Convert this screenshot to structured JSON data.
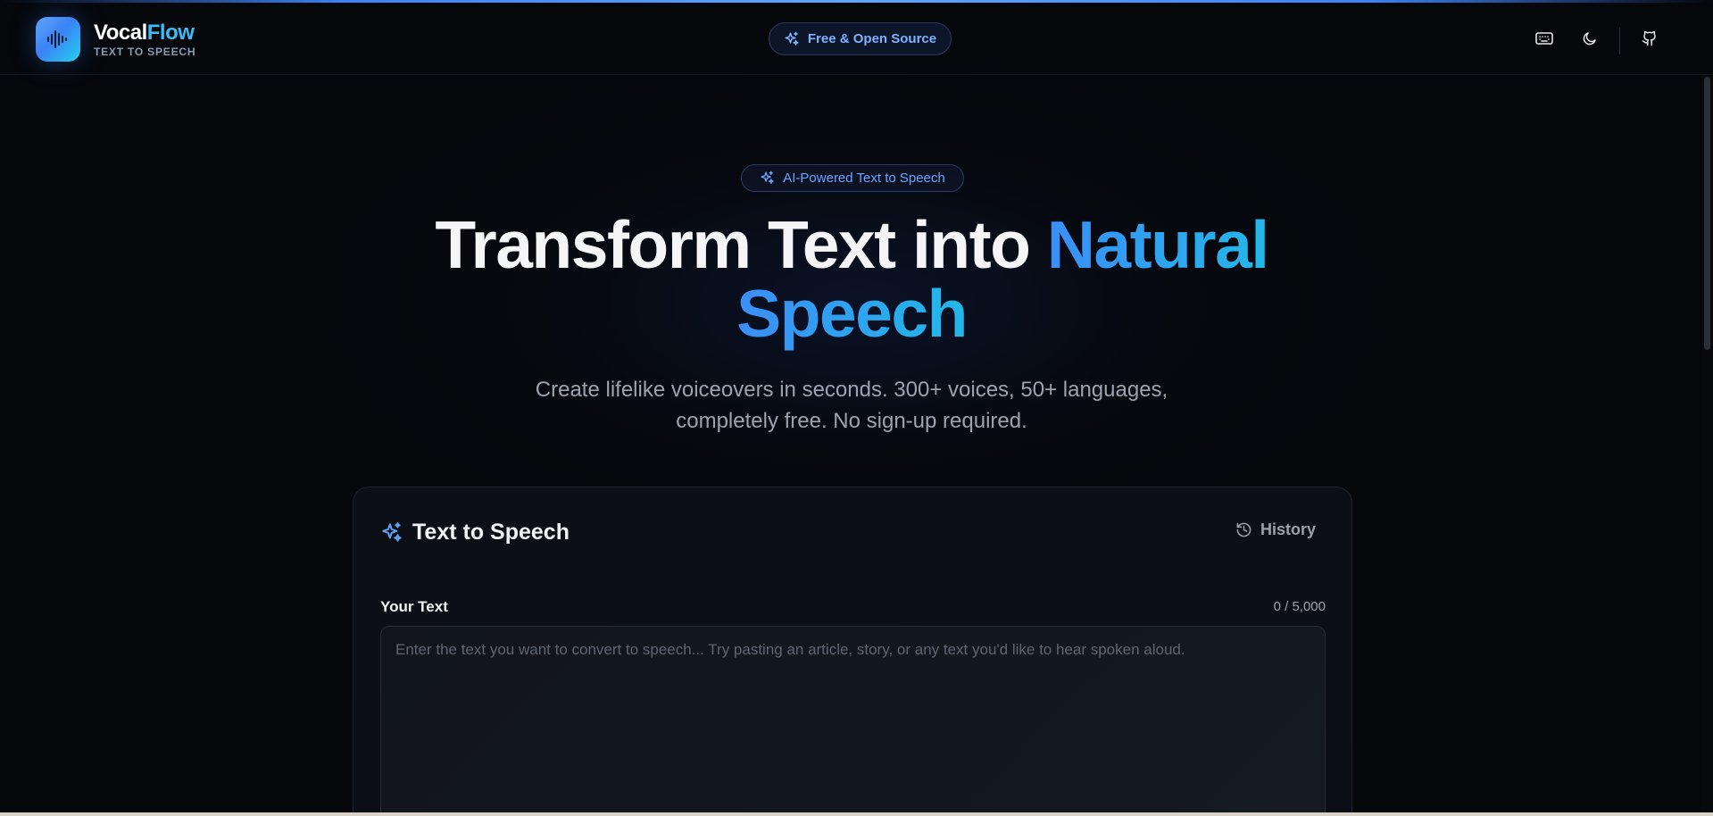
{
  "header": {
    "brand_part1": "Vocal",
    "brand_part2": "Flow",
    "brand_subtitle": "TEXT TO SPEECH",
    "badge_label": "Free & Open Source",
    "icons": [
      "keyboard-icon",
      "moon-icon",
      "github-icon"
    ]
  },
  "hero": {
    "badge_label": "AI-Powered Text to Speech",
    "title_plain": "Transform Text into ",
    "title_highlight_1": "Natural",
    "title_highlight_2": "Speech",
    "subtitle_line1": "Create lifelike voiceovers in seconds. 300+ voices, 50+ languages,",
    "subtitle_line2": "completely free. No sign-up required."
  },
  "tts_card": {
    "title": "Text to Speech",
    "history_label": "History",
    "text_label": "Your Text",
    "char_count": "0 / 5,000",
    "text_value": "",
    "text_placeholder": "Enter the text you want to convert to speech... Try pasting an article, story, or any text you'd like to hear spoken aloud."
  },
  "colors": {
    "accent": "#3b82f6",
    "accent_cyan": "#22d3ee",
    "background": "#05070b",
    "card_bg": "#0c1016"
  }
}
